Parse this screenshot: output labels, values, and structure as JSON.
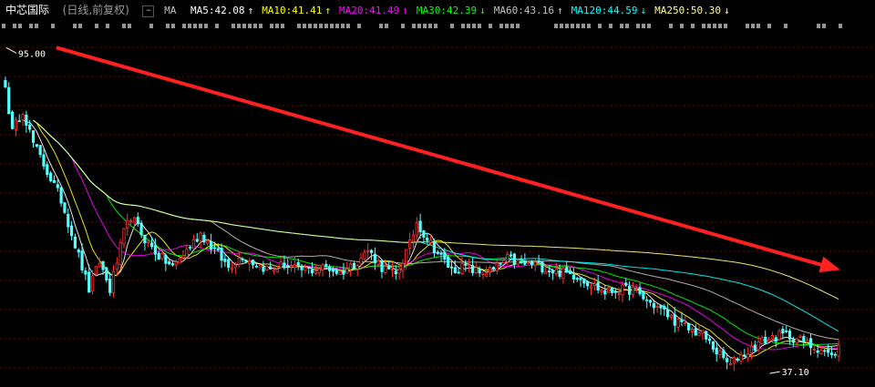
{
  "header": {
    "stock_name": "中芯国际",
    "period": "(日线,前复权)",
    "ma_toggle_icon": "minus-box-icon",
    "ma_title": "MA",
    "ma_items": [
      {
        "label": "MA5:42.08",
        "color": "#ffffff",
        "arrow": "↑"
      },
      {
        "label": "MA10:41.41",
        "color": "#ffff00",
        "arrow": "↑"
      },
      {
        "label": "MA20:41.49",
        "color": "#ff00ff",
        "arrow": "↑"
      },
      {
        "label": "MA30:42.39",
        "color": "#00ff00",
        "arrow": "↓"
      },
      {
        "label": "MA60:43.16",
        "color": "#c0c0c0",
        "arrow": "↑"
      },
      {
        "label": "MA120:44.59",
        "color": "#00ffff",
        "arrow": "↓"
      },
      {
        "label": "MA250:50.30",
        "color": "#ffff80",
        "arrow": "↓"
      }
    ]
  },
  "colors": {
    "background": "#000000",
    "grid": "#7a0000",
    "up_candle": "#ff3232",
    "down_candle": "#54ffff",
    "trend_arrow": "#ff2020",
    "event_marks": "#c8c8c8"
  },
  "chart_data": {
    "type": "candlestick",
    "title": "中芯国际 (日线,前复权)",
    "ylim": [
      35.5,
      97
    ],
    "grid": "horizontal dashed",
    "annotations": [
      {
        "label": "95.00",
        "meaning": "high",
        "value": 95.0,
        "index": 0
      },
      {
        "label": "37.10",
        "meaning": "low",
        "value": 37.1,
        "index": 219
      }
    ],
    "trend_arrow": {
      "from_value": 95.0,
      "to_value": 55.5,
      "direction": "down"
    },
    "anchor_closes": [
      [
        0,
        88
      ],
      [
        2,
        80
      ],
      [
        5,
        84
      ],
      [
        8,
        78
      ],
      [
        12,
        73
      ],
      [
        16,
        68
      ],
      [
        20,
        60
      ],
      [
        24,
        52
      ],
      [
        27,
        57
      ],
      [
        30,
        52
      ],
      [
        34,
        62
      ],
      [
        36,
        65
      ],
      [
        40,
        61
      ],
      [
        44,
        58
      ],
      [
        48,
        56
      ],
      [
        52,
        59
      ],
      [
        56,
        62
      ],
      [
        60,
        59
      ],
      [
        64,
        56
      ],
      [
        68,
        58
      ],
      [
        72,
        56.5
      ],
      [
        76,
        55.5
      ],
      [
        80,
        56.5
      ],
      [
        84,
        55.5
      ],
      [
        88,
        55.5
      ],
      [
        92,
        56
      ],
      [
        96,
        55
      ],
      [
        100,
        56.5
      ],
      [
        104,
        59
      ],
      [
        108,
        56
      ],
      [
        112,
        54.5
      ],
      [
        116,
        60
      ],
      [
        118,
        64
      ],
      [
        120,
        62
      ],
      [
        124,
        58.5
      ],
      [
        128,
        55.5
      ],
      [
        132,
        56
      ],
      [
        136,
        55
      ],
      [
        140,
        55.5
      ],
      [
        144,
        57.5
      ],
      [
        148,
        56.5
      ],
      [
        152,
        56.5
      ],
      [
        156,
        55.5
      ],
      [
        160,
        55
      ],
      [
        164,
        54.5
      ],
      [
        168,
        53
      ],
      [
        172,
        51.5
      ],
      [
        176,
        52
      ],
      [
        180,
        52
      ],
      [
        184,
        50
      ],
      [
        188,
        48.5
      ],
      [
        192,
        46.5
      ],
      [
        196,
        45
      ],
      [
        200,
        44
      ],
      [
        204,
        41
      ],
      [
        208,
        38.5
      ],
      [
        210,
        40
      ],
      [
        213,
        41
      ],
      [
        216,
        42.5
      ],
      [
        220,
        43.5
      ],
      [
        224,
        44
      ],
      [
        228,
        43
      ],
      [
        231,
        42
      ],
      [
        234,
        41.5
      ],
      [
        237,
        40
      ],
      [
        239,
        42.1
      ]
    ],
    "moving_averages": [
      {
        "name": "MA5",
        "period": 5,
        "value": 42.08
      },
      {
        "name": "MA10",
        "period": 10,
        "value": 41.41
      },
      {
        "name": "MA20",
        "period": 20,
        "value": 41.49
      },
      {
        "name": "MA30",
        "period": 30,
        "value": 42.39
      },
      {
        "name": "MA60",
        "period": 60,
        "value": 43.16
      },
      {
        "name": "MA120",
        "period": 120,
        "value": 44.59
      },
      {
        "name": "MA250",
        "period": 250,
        "value": 50.3
      }
    ]
  }
}
